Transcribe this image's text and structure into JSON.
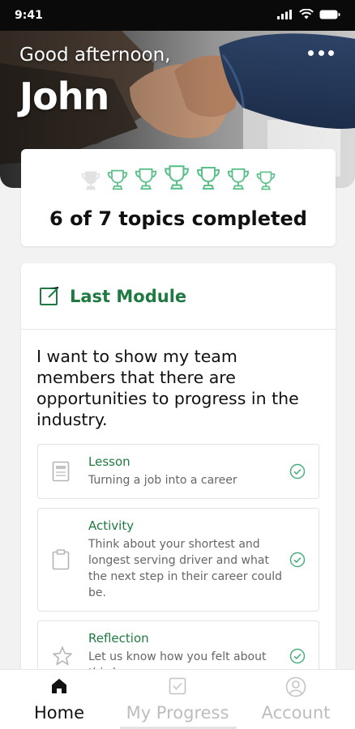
{
  "status_bar": {
    "time": "9:41"
  },
  "header": {
    "greeting": "Good afternoon,",
    "user_name": "John"
  },
  "progress": {
    "completed": 6,
    "total": 7,
    "summary": "6 of 7 topics completed"
  },
  "module": {
    "title": "Last Module",
    "description": "I want to show my team members that there are opportunities to progress in the industry.",
    "items": [
      {
        "type": "Lesson",
        "text": "Turning a job into a career",
        "icon": "document-icon",
        "completed": true
      },
      {
        "type": "Activity",
        "text": "Think about your shortest and longest serving driver and what the next step in their career could be.",
        "icon": "clipboard-icon",
        "completed": true
      },
      {
        "type": "Reflection",
        "text": "Let us know how you felt about this lesson",
        "icon": "star-icon",
        "completed": true
      }
    ]
  },
  "tabs": [
    {
      "label": "Home",
      "icon": "home-icon",
      "active": true
    },
    {
      "label": "My Progress",
      "icon": "checkbox-icon",
      "active": false
    },
    {
      "label": "Account",
      "icon": "user-circle-icon",
      "active": false
    }
  ],
  "colors": {
    "accent": "#1f7a42",
    "trophy": "#5cc08a",
    "trophy_inactive": "#e2e2e2",
    "check": "#4cae7a"
  }
}
